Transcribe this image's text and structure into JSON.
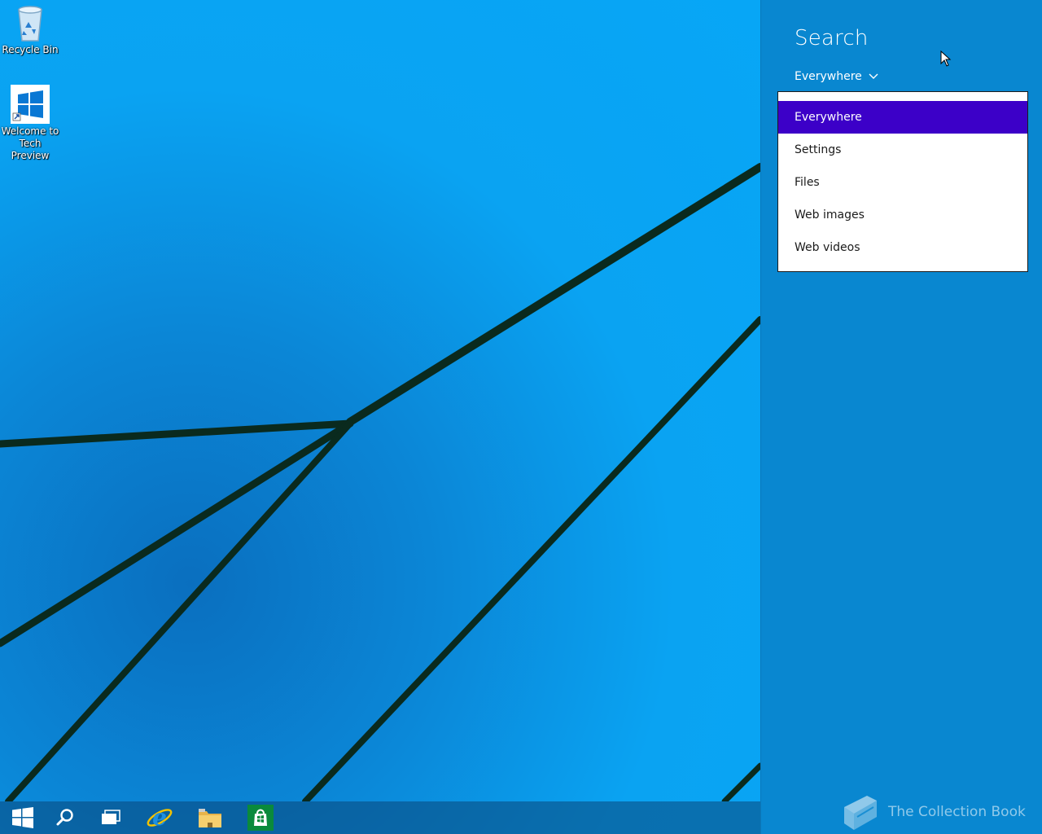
{
  "desktop": {
    "icons": [
      {
        "label": "Recycle Bin",
        "icon": "recycle-bin-icon"
      },
      {
        "label": "Welcome to\nTech Preview",
        "icon": "windows-logo-icon"
      }
    ]
  },
  "taskbar": {
    "buttons": [
      {
        "icon": "start-icon"
      },
      {
        "icon": "search-icon"
      },
      {
        "icon": "task-view-icon"
      },
      {
        "icon": "internet-explorer-icon"
      },
      {
        "icon": "file-explorer-icon"
      },
      {
        "icon": "store-icon"
      }
    ]
  },
  "search_pane": {
    "title": "Search",
    "scope_selected": "Everywhere",
    "options": [
      {
        "label": "Everywhere",
        "selected": true
      },
      {
        "label": "Settings",
        "selected": false
      },
      {
        "label": "Files",
        "selected": false
      },
      {
        "label": "Web images",
        "selected": false
      },
      {
        "label": "Web videos",
        "selected": false
      }
    ]
  },
  "watermark": {
    "text": "The Collection Book",
    "icon": "book-icon"
  },
  "colors": {
    "charm_bg": "#0987d0",
    "selected_bg": "#3c00c8",
    "store_green": "#0a8a3c"
  }
}
